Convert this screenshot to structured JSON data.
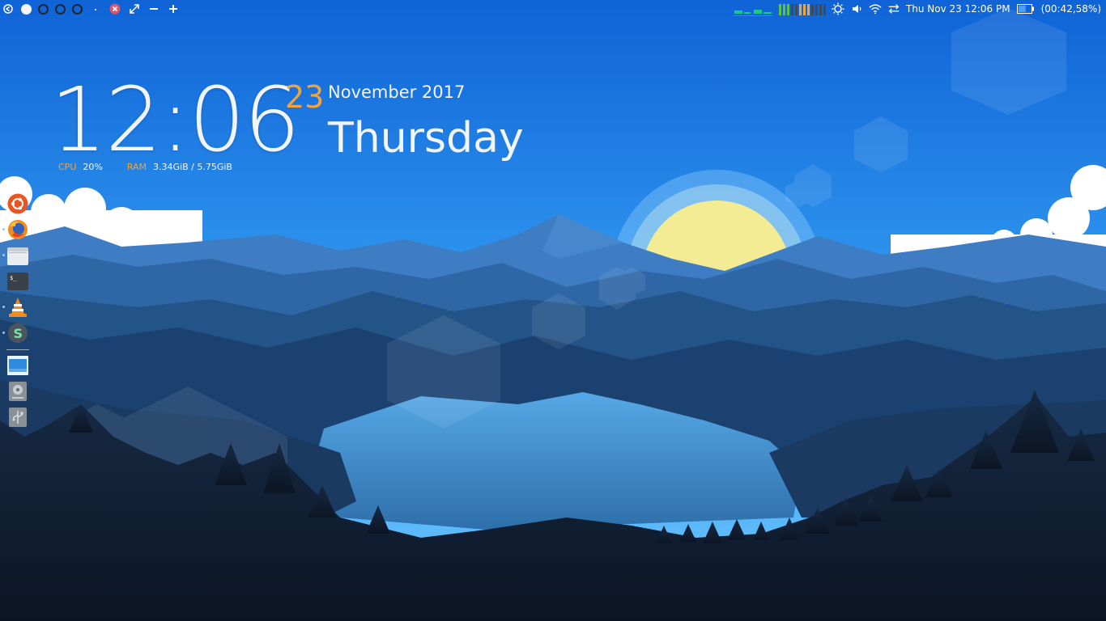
{
  "topbar": {
    "workspaces": [
      {
        "active": true
      },
      {
        "active": false
      },
      {
        "active": false
      },
      {
        "active": false
      }
    ],
    "datetime": "Thu Nov 23 12:06 PM",
    "battery_status": "(00:42,58%)",
    "battery_level": 0.58,
    "colors": {
      "meter_green": "#5cc24d",
      "meter_orange": "#f2a33a",
      "meter_dim": "#3e4a55",
      "net_graph": "#18c98a",
      "close_icon": "#e0546a"
    }
  },
  "clock": {
    "time": "12:06",
    "day": "23",
    "month_year": "November 2017",
    "weekday": "Thursday"
  },
  "system": {
    "cpu_label": "CPU",
    "cpu_value": "20%",
    "ram_label": "RAM",
    "ram_value": "3.34GiB / 5.75GiB"
  },
  "dock": {
    "items": [
      {
        "icon": "ubuntu-icon",
        "running": false
      },
      {
        "icon": "firefox-icon",
        "running": true
      },
      {
        "icon": "file-manager-icon",
        "running": true
      },
      {
        "icon": "terminal-icon",
        "running": false
      },
      {
        "icon": "vlc-icon",
        "running": true
      },
      {
        "icon": "screenshot-app-icon",
        "running": true
      },
      {
        "icon": "desktop-icon",
        "running": false
      },
      {
        "icon": "disk-drive-icon",
        "running": false
      },
      {
        "icon": "usb-drive-icon",
        "running": false
      }
    ]
  },
  "wallpaper": {
    "colors": {
      "sky_top": "#0f63d6",
      "sky_horizon": "#6cc6ff",
      "sun": "#f4ec95",
      "mountain_far": "#3e7cc4",
      "mountain_mid": "#2a5a8e",
      "lake": "#3f8fd0",
      "forest": "#0f1a2c"
    }
  }
}
